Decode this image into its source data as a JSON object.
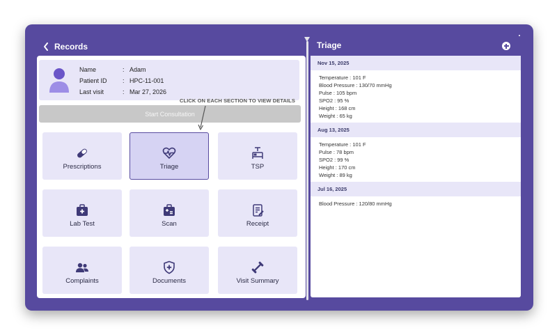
{
  "left": {
    "title": "Records",
    "patient": {
      "name_label": "Name",
      "name_value": "Adam",
      "id_label": "Patient ID",
      "id_value": "HPC-11-001",
      "visit_label": "Last visit",
      "visit_value": "Mar 27, 2026",
      "colon": ":"
    },
    "start_button": "Start Consultation",
    "hint": "CLICK ON EACH SECTION TO VIEW DETAILS",
    "tiles": [
      {
        "label": "Prescriptions",
        "icon": "pill-icon"
      },
      {
        "label": "Triage",
        "icon": "heartbeat-icon",
        "selected": true
      },
      {
        "label": "TSP",
        "icon": "bed-icon"
      },
      {
        "label": "Lab Test",
        "icon": "medical-kit-icon"
      },
      {
        "label": "Scan",
        "icon": "scan-icon"
      },
      {
        "label": "Receipt",
        "icon": "receipt-icon"
      },
      {
        "label": "Complaints",
        "icon": "users-icon"
      },
      {
        "label": "Documents",
        "icon": "shield-icon"
      },
      {
        "label": "Visit Summary",
        "icon": "dumbbell-icon"
      }
    ]
  },
  "right": {
    "title": "Triage",
    "entries": [
      {
        "date": "Nov 15, 2025",
        "vitals": [
          "Temperature : 101 F",
          "Blood Pressure : 130/70 mmHg",
          "Pulse : 105 bpm",
          "SPO2 : 95 %",
          "Height : 168 cm",
          "Weight : 65 kg"
        ]
      },
      {
        "date": "Aug 13, 2025",
        "vitals": [
          "Temperature : 101 F",
          "Pulse : 78 bpm",
          "SPO2 : 99 %",
          "Height : 170 cm",
          "Weight : 89 kg"
        ]
      },
      {
        "date": "Jul 16, 2025",
        "vitals": [
          "Blood Pressure : 120/80 mmHg"
        ]
      }
    ]
  },
  "colors": {
    "primary": "#574a9f",
    "tile_bg": "#e8e6f8",
    "tile_selected": "#d6d3f3",
    "disabled": "#c8c8c8"
  }
}
